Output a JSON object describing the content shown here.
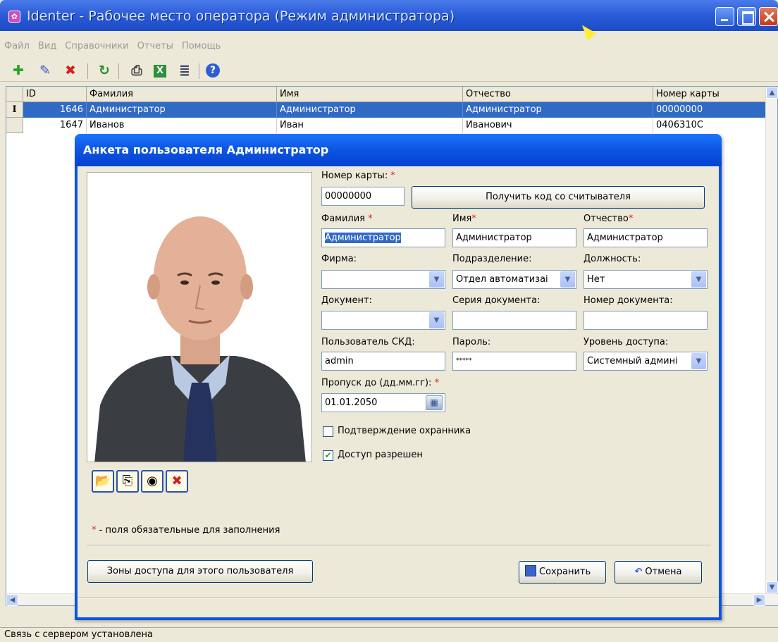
{
  "window": {
    "title": "Identer - Рабочее место оператора (Режим администратора)"
  },
  "menu": [
    "Файл",
    "Вид",
    "Справочники",
    "Отчеты",
    "Помощь"
  ],
  "toolbar": {
    "add": "✚",
    "edit": "✎",
    "delete": "✖",
    "refresh": "↻",
    "print": "⎙",
    "excel": "X",
    "report": "≣",
    "help": "?"
  },
  "grid": {
    "columns": [
      "ID",
      "Фамилия",
      "Имя",
      "Отчество",
      "Номер карты"
    ],
    "rows": [
      {
        "indicator": "I",
        "id": "1646",
        "last": "Администратор",
        "first": "Администратор",
        "middle": "Администратор",
        "card": "00000000"
      },
      {
        "indicator": "",
        "id": "1647",
        "last": "Иванов",
        "first": "Иван",
        "middle": "Иванович",
        "card": "0406310C"
      }
    ]
  },
  "status": "Связь с сервером установлена",
  "dialog": {
    "title": "Анкета пользователя Администратор",
    "card_label": "Номер карты:",
    "card_value": "00000000",
    "read_button": "Получить код со считывателя",
    "last_label": "Фамилия",
    "last_value": "Администратор",
    "first_label": "Имя",
    "first_value": "Администратор",
    "middle_label": "Отчество",
    "middle_value": "Администратор",
    "firm_label": "Фирма:",
    "firm_value": "",
    "dept_label": "Подразделение:",
    "dept_value": "Отдел автоматизаі",
    "position_label": "Должность:",
    "position_value": "Нет",
    "doc_label": "Документ:",
    "doc_value": "",
    "series_label": "Серия документа:",
    "series_value": "",
    "docnum_label": "Номер документа:",
    "docnum_value": "",
    "skd_label": "Пользователь СКД:",
    "skd_value": "admin",
    "password_label": "Пароль:",
    "password_value": "*****",
    "access_label": "Уровень доступа:",
    "access_value": "Системный админі",
    "pass_label": "Пропуск до (дд.мм.гг):",
    "pass_value": "01.01.2050",
    "confirm_label": "Подтверждение охранника",
    "confirm_checked": false,
    "allowed_label": "Доступ разрешен",
    "allowed_checked": true,
    "required_mark": "*",
    "required_note": "- поля обязательные для заполнения",
    "zones_button": "Зоны доступа для этого пользователя",
    "save_button": "Сохранить",
    "cancel_button": "Отмена"
  }
}
